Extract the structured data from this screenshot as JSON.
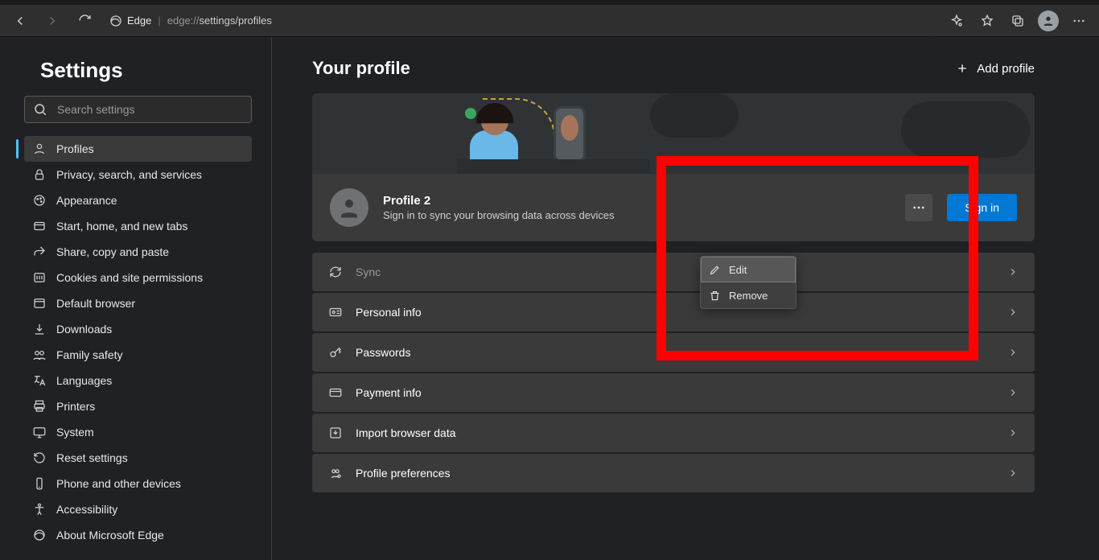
{
  "browser": {
    "brand": "Edge",
    "url_prefix": "edge://",
    "url_path": "settings/profiles"
  },
  "sidebar": {
    "title": "Settings",
    "search_placeholder": "Search settings",
    "items": [
      {
        "label": "Profiles",
        "icon": "person-icon",
        "active": true
      },
      {
        "label": "Privacy, search, and services",
        "icon": "lock-icon"
      },
      {
        "label": "Appearance",
        "icon": "paint-icon"
      },
      {
        "label": "Start, home, and new tabs",
        "icon": "tab-icon"
      },
      {
        "label": "Share, copy and paste",
        "icon": "share-icon"
      },
      {
        "label": "Cookies and site permissions",
        "icon": "cookie-icon"
      },
      {
        "label": "Default browser",
        "icon": "browser-icon"
      },
      {
        "label": "Downloads",
        "icon": "download-icon"
      },
      {
        "label": "Family safety",
        "icon": "family-icon"
      },
      {
        "label": "Languages",
        "icon": "language-icon"
      },
      {
        "label": "Printers",
        "icon": "printer-icon"
      },
      {
        "label": "System",
        "icon": "system-icon"
      },
      {
        "label": "Reset settings",
        "icon": "reset-icon"
      },
      {
        "label": "Phone and other devices",
        "icon": "phone-icon"
      },
      {
        "label": "Accessibility",
        "icon": "accessibility-icon"
      },
      {
        "label": "About Microsoft Edge",
        "icon": "edge-icon"
      }
    ]
  },
  "main": {
    "title": "Your profile",
    "add_profile": "Add profile",
    "profile": {
      "name": "Profile 2",
      "subtitle": "Sign in to sync your browsing data across devices",
      "signin": "Sign in"
    },
    "menu": {
      "edit": "Edit",
      "remove": "Remove"
    },
    "rows": [
      {
        "label": "Sync",
        "icon": "sync-icon",
        "disabled": true
      },
      {
        "label": "Personal info",
        "icon": "id-icon"
      },
      {
        "label": "Passwords",
        "icon": "key-icon"
      },
      {
        "label": "Payment info",
        "icon": "card-icon"
      },
      {
        "label": "Import browser data",
        "icon": "import-icon"
      },
      {
        "label": "Profile preferences",
        "icon": "prefs-icon"
      }
    ]
  }
}
